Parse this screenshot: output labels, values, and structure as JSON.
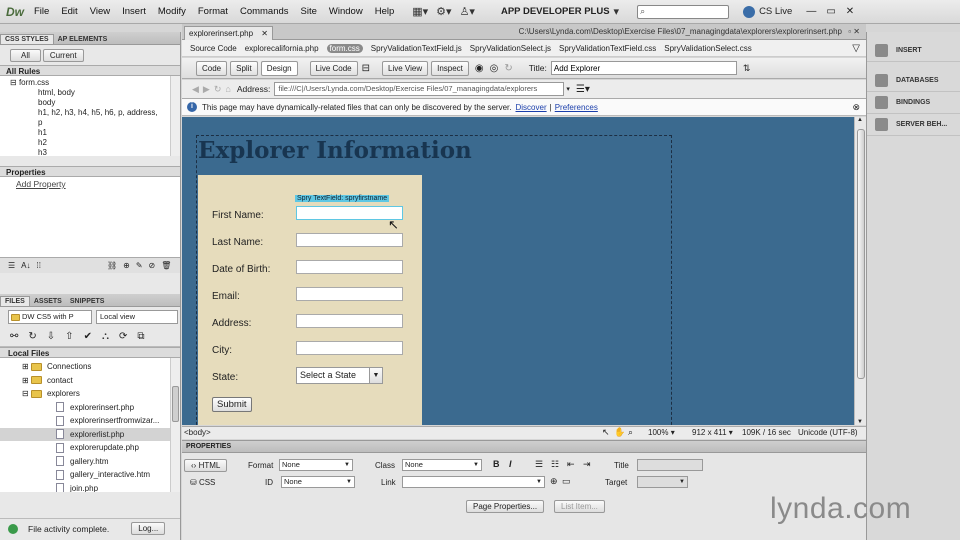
{
  "app": {
    "logo": "Dw"
  },
  "menus": [
    "File",
    "Edit",
    "View",
    "Insert",
    "Modify",
    "Format",
    "Commands",
    "Site",
    "Window",
    "Help"
  ],
  "workspace": "APP DEVELOPER PLUS",
  "cslive": "CS Live",
  "left_panel": {
    "tabs": [
      "CSS STYLES",
      "AP ELEMENTS"
    ],
    "mode_buttons": [
      "All",
      "Current"
    ],
    "all_rules_header": "All Rules",
    "rules": [
      "form.css",
      "html, body",
      "body",
      "h1, h2, h3, h4, h5, h6, p, address,",
      "p",
      "h1",
      "h2",
      "h3"
    ],
    "properties_header": "Properties",
    "add_property": "Add Property"
  },
  "files_panel": {
    "tabs": [
      "FILES",
      "ASSETS",
      "SNIPPETS"
    ],
    "site_select": "DW CS5 with P",
    "view_select": "Local view",
    "local_files_header": "Local Files",
    "items": [
      {
        "name": "Connections",
        "type": "folder",
        "indent": 1
      },
      {
        "name": "contact",
        "type": "folder",
        "indent": 1
      },
      {
        "name": "explorers",
        "type": "folder",
        "indent": 1
      },
      {
        "name": "explorerinsert.php",
        "type": "file",
        "indent": 2
      },
      {
        "name": "explorerinsertfromwizar...",
        "type": "file",
        "indent": 2
      },
      {
        "name": "explorerlist.php",
        "type": "file",
        "indent": 2
      },
      {
        "name": "explorerupdate.php",
        "type": "file",
        "indent": 2
      },
      {
        "name": "gallery.htm",
        "type": "file",
        "indent": 2
      },
      {
        "name": "gallery_interactive.htm",
        "type": "file",
        "indent": 2
      },
      {
        "name": "join.php",
        "type": "file",
        "indent": 2
      }
    ],
    "status": "File activity complete.",
    "log_button": "Log..."
  },
  "document": {
    "tab": "explorerinsert.php",
    "path": "C:\\Users\\Lynda.com\\Desktop\\Exercise Files\\07_managingdata\\explorers\\explorerinsert.php",
    "related_files": [
      "Source Code",
      "explorecalifornia.php",
      "form.css",
      "SpryValidationTextField.js",
      "SpryValidationSelect.js",
      "SpryValidationTextField.css",
      "SpryValidationSelect.css"
    ],
    "view_buttons": [
      "Code",
      "Split",
      "Design"
    ],
    "live_buttons": [
      "Live Code",
      "Live View",
      "Inspect"
    ],
    "title_label": "Title:",
    "title_value": "Add Explorer",
    "address_label": "Address:",
    "address_value": "file:///C|/Users/Lynda.com/Desktop/Exercise Files/07_managingdata/explorers",
    "info_text": "This page may have dynamically-related files that can only be discovered by the server.",
    "discover": "Discover",
    "preferences": "Preferences"
  },
  "page": {
    "heading": "Explorer Information",
    "spry_label": "Spry TextField: spryfirstname",
    "fields": [
      "First Name:",
      "Last Name:",
      "Date of Birth:",
      "Email:",
      "Address:",
      "City:"
    ],
    "state_label": "State:",
    "state_select": "Select a State",
    "submit": "Submit"
  },
  "statusbar": {
    "tag": "<body>",
    "zoom": "100%",
    "size": "912 x 411",
    "download": "109K / 16 sec",
    "encoding": "Unicode (UTF-8)"
  },
  "properties": {
    "header": "PROPERTIES",
    "html_button": "HTML",
    "css_button": "CSS",
    "format_label": "Format",
    "format_value": "None",
    "class_label": "Class",
    "class_value": "None",
    "id_label": "ID",
    "id_value": "None",
    "link_label": "Link",
    "title_label": "Title",
    "target_label": "Target",
    "page_properties": "Page Properties...",
    "list_item": "List Item..."
  },
  "right_panel": [
    "INSERT",
    "DATABASES",
    "BINDINGS",
    "SERVER BEH..."
  ],
  "watermark": "lynda.com"
}
